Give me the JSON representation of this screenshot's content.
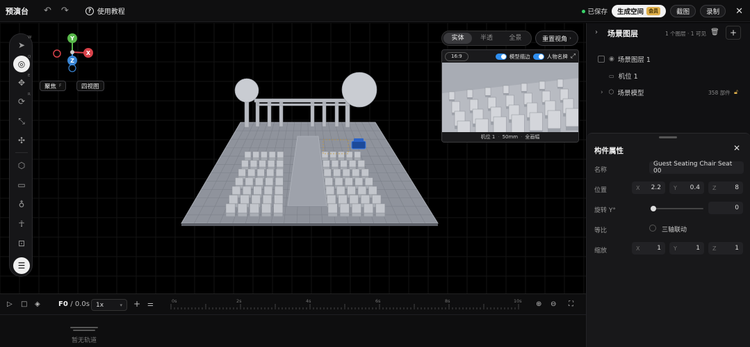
{
  "app": {
    "title": "预演台",
    "tutorial": "使用教程"
  },
  "header": {
    "saved": "已保存",
    "generate_label": "生成空间",
    "generate_badge": "会员",
    "screenshot": "截图",
    "record": "录制"
  },
  "viewport": {
    "gizmo": {
      "y": "Y",
      "x": "X",
      "z": "Z"
    },
    "focus_label": "聚焦",
    "focus_key": "F",
    "four_view": "四视图",
    "view_modes": [
      "实体",
      "半透",
      "全景"
    ],
    "view_mode_selected": "实体",
    "reset_view": "重置视角",
    "toolbar_hotkeys": [
      "W",
      "Q",
      "E",
      "R"
    ],
    "preview": {
      "ratio": "16:9",
      "toggle_model": "模型描边",
      "toggle_person": "人物名牌",
      "footer_cam": "机位 1",
      "footer_lens": "50mm",
      "footer_mode": "全画幅"
    }
  },
  "timeline": {
    "frame": "F0",
    "time": "/ 0.0s",
    "speed": "1x",
    "ticks": [
      "0s",
      "2s",
      "4s",
      "6s",
      "8s",
      "10s"
    ],
    "empty": "暂无轨道"
  },
  "scene_panel": {
    "title": "场景图层",
    "counts": "1 个图层 · 1 可见",
    "layer": "场景图层 1",
    "camera": "机位 1",
    "model": "场景模型",
    "model_count": "358 部件"
  },
  "props": {
    "title": "构件属性",
    "name_label": "名称",
    "name_value": "Guest Seating Chair Seat 00",
    "position_label": "位置",
    "position": {
      "x": "2.2",
      "y": "0.4",
      "z": "8"
    },
    "rotation_label": "旋转 Y°",
    "rotation_value": "0",
    "rotation_fraction": 0.0,
    "uniform_label": "等比",
    "uniform_option": "三轴联动",
    "scale_label": "缩放",
    "scale": {
      "x": "1",
      "y": "1",
      "z": "1"
    },
    "axis_x": "X",
    "axis_y": "Y",
    "axis_z": "Z"
  },
  "colors": {
    "accent_blue": "#2e8ef0",
    "saved_green": "#3ad26a",
    "badge_gold": "#e0b04a",
    "gizmo_x": "#d9424a",
    "gizmo_y": "#58b84a",
    "gizmo_z": "#3a86d6"
  }
}
